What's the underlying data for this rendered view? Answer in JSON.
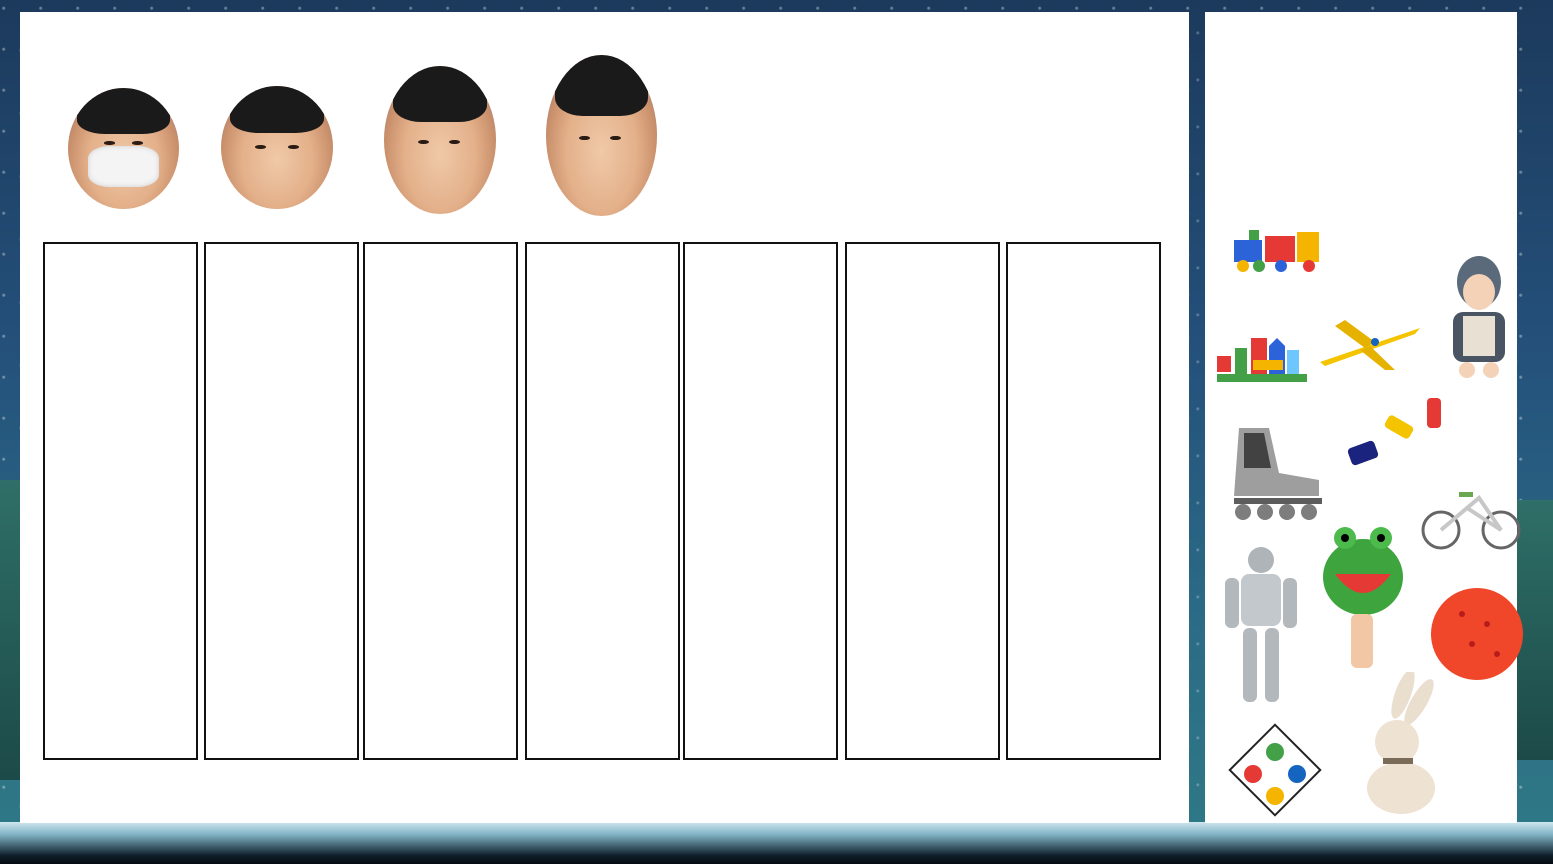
{
  "children": [
    {
      "name": "child-1",
      "has_mask": true
    },
    {
      "name": "child-2",
      "has_mask": false
    },
    {
      "name": "child-3",
      "has_mask": false
    },
    {
      "name": "child-4",
      "has_mask": false
    }
  ],
  "columns_count": 7,
  "toys": [
    "toy-train-icon",
    "building-blocks-icon",
    "toy-airplane-icon",
    "doll-icon",
    "inline-skate-icon",
    "toy-cars-icon",
    "bicycle-icon",
    "robot-figure-icon",
    "frog-puppet-icon",
    "red-ball-icon",
    "board-game-icon",
    "plush-bunny-icon"
  ],
  "colors": {
    "panel": "#ffffff",
    "border": "#111111",
    "background": "#24507a"
  }
}
